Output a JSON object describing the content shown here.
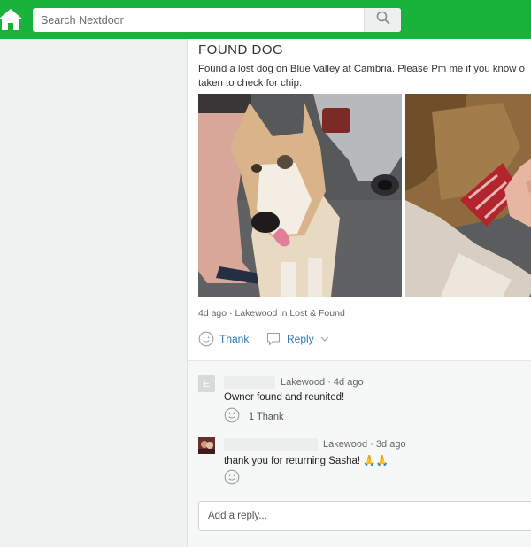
{
  "header": {
    "search_placeholder": "Search Nextdoor",
    "brand_color": "#19b23b"
  },
  "post": {
    "title": "FOUND DOG",
    "body": "Found a lost dog on Blue Valley at Cambria.  Please Pm me if you know o taken to check for chip.",
    "meta": "4d ago · Lakewood in Lost & Found",
    "thank_label": "Thank",
    "reply_label": "Reply"
  },
  "comments": [
    {
      "avatar_letter": "E",
      "location_time": "Lakewood · 4d ago",
      "text": "Owner found and reunited!",
      "thanks": "1 Thank"
    },
    {
      "location_time": "Lakewood · 3d ago",
      "text": "thank you for returning Sasha! 🙏🙏"
    }
  ],
  "reply_placeholder": "Add a reply...",
  "accent_link_color": "#2c79b3"
}
